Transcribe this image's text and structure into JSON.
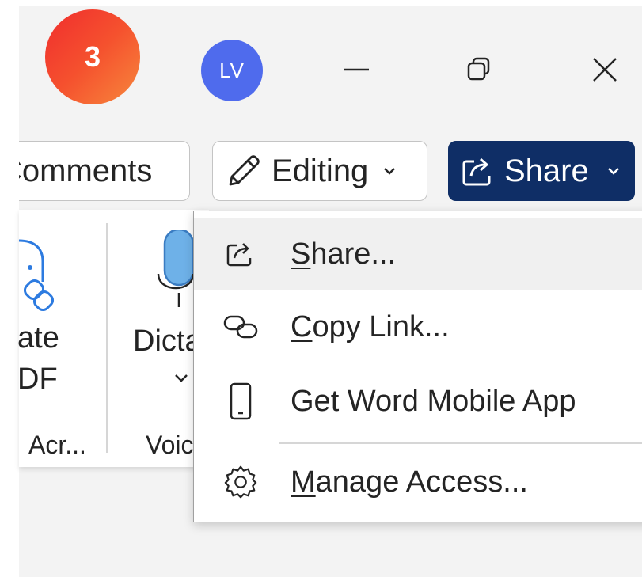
{
  "step": {
    "number": "3"
  },
  "titlebar": {
    "avatar_initials": "LV"
  },
  "toolbar": {
    "comments_label": "Comments",
    "editing_label": "Editing",
    "share_label": "Share"
  },
  "ribbon": {
    "create_pdf_line1": "ate",
    "create_pdf_line2": "DF",
    "group_acrobat": "Acr...",
    "dictate_label": "Dicta",
    "group_voice": "Voic"
  },
  "share_menu": {
    "items": [
      {
        "label_access_key": "S",
        "label_rest": "hare...",
        "icon": "share-icon"
      },
      {
        "label_access_key": "C",
        "label_rest": "opy Link...",
        "icon": "link-icon"
      },
      {
        "label": "Get Word Mobile App",
        "icon": "mobile-phone-icon"
      },
      {
        "label_access_key": "M",
        "label_rest": "anage Access...",
        "icon": "gear-icon"
      }
    ]
  },
  "colors": {
    "share_button_bg": "#0f2e66",
    "avatar_bg": "#4f6bed",
    "badge_gradient_start": "#f02d2d",
    "badge_gradient_end": "#f7883c",
    "mic_accent": "#6eb1e8"
  }
}
